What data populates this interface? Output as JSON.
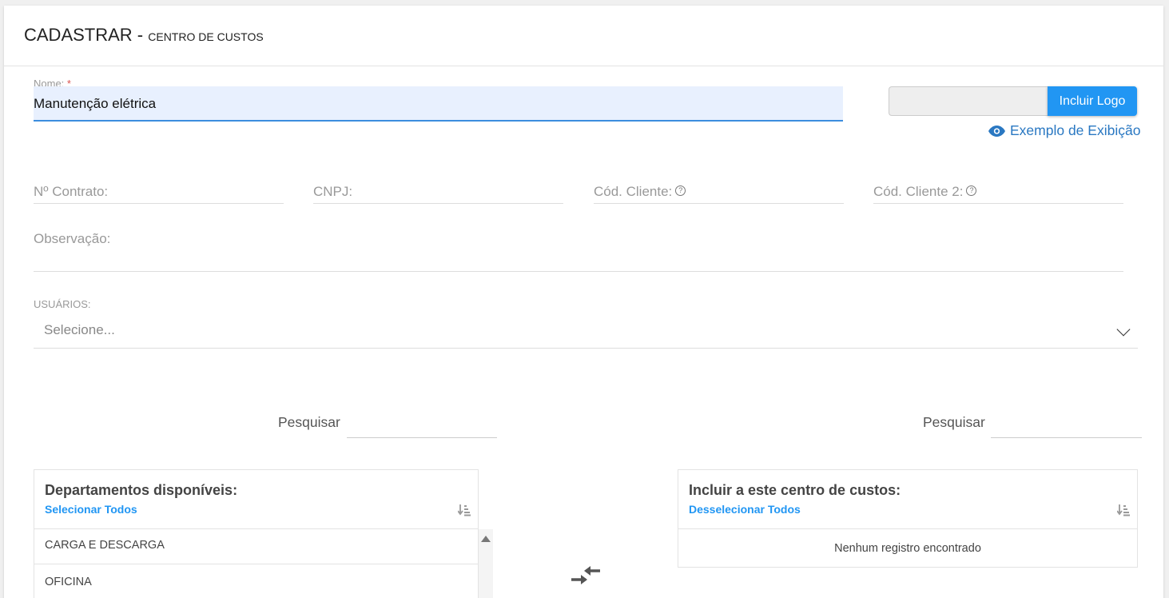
{
  "header": {
    "title": "CADASTRAR - ",
    "subtitle": "CENTRO DE CUSTOS"
  },
  "form": {
    "nome_label": "Nome:",
    "nome_required": "*",
    "nome_value": "Manutenção elétrica",
    "logo_button": "Incluir Logo",
    "exemplo_link": "Exemplo de Exibição",
    "contrato_label": "Nº Contrato:",
    "cnpj_label": "CNPJ:",
    "cod_cliente_label": "Cód. Cliente:",
    "cod_cliente2_label": "Cód. Cliente 2:",
    "help_glyph": "?",
    "observacao_label": "Observação:",
    "usuarios_label": "USUÁRIOS:",
    "usuarios_placeholder": "Selecione..."
  },
  "left_panel": {
    "search_label": "Pesquisar",
    "title": "Departamentos disponíveis:",
    "select_all": "Selecionar Todos",
    "items": [
      "CARGA E DESCARGA",
      "OFICINA"
    ]
  },
  "right_panel": {
    "search_label": "Pesquisar",
    "title": "Incluir a este centro de custos:",
    "deselect_all": "Desselecionar Todos",
    "empty_text": "Nenhum registro encontrado"
  },
  "colors": {
    "accent": "#2196f3",
    "link": "#2a78c2",
    "required": "#d9534f"
  },
  "icons": {
    "exemplo": "eye-icon",
    "transfer": "transfer-arrows-icon",
    "sort": "sort-icon",
    "scroll_up": "scroll-up-arrow-icon",
    "select": "chevron-down-icon"
  }
}
